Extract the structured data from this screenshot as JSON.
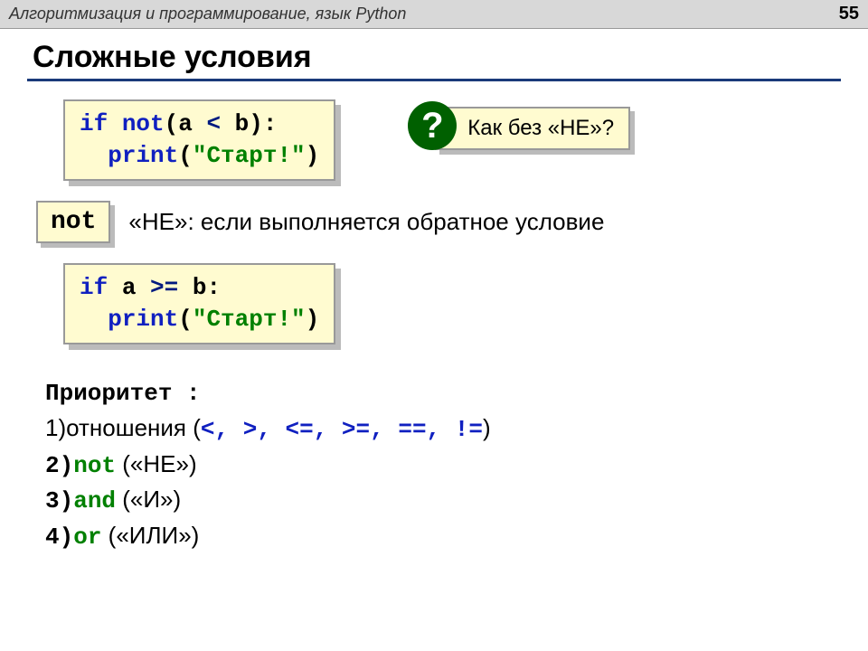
{
  "header": {
    "title": "Алгоритмизация и программирование, язык Python",
    "page": "55"
  },
  "main_title": "Сложные условия",
  "code1": {
    "kw_if": "if",
    "kw_not": "not",
    "expr_open": "(a ",
    "lt": "<",
    "expr_close": " b):",
    "print_kw": "print",
    "paren_open": "(",
    "str": "\"Старт!\"",
    "paren_close": ")"
  },
  "callout": {
    "qmark": "?",
    "text": "Как без «НЕ»?"
  },
  "not_box": "not",
  "desc": "«НЕ»: если выполняется обратное условие",
  "code2": {
    "kw_if": "if",
    "expr": " a ",
    "gte": ">=",
    "expr2": " b:",
    "print_kw": "print",
    "paren_open": "(",
    "str": "\"Старт!\"",
    "paren_close": ")"
  },
  "priority": {
    "title": "Приоритет :",
    "line1_pre": "1)отношения (",
    "line1_ops": "<, >, <=, >=, ==, !=",
    "line1_post": ")",
    "line2_num": "2)",
    "line2_kw": "not",
    "line2_post": " («НЕ»)",
    "line3_num": "3)",
    "line3_kw": "and",
    "line3_post": " («И»)",
    "line4_num": "4)",
    "line4_kw": "or",
    "line4_post": " («ИЛИ»)"
  }
}
